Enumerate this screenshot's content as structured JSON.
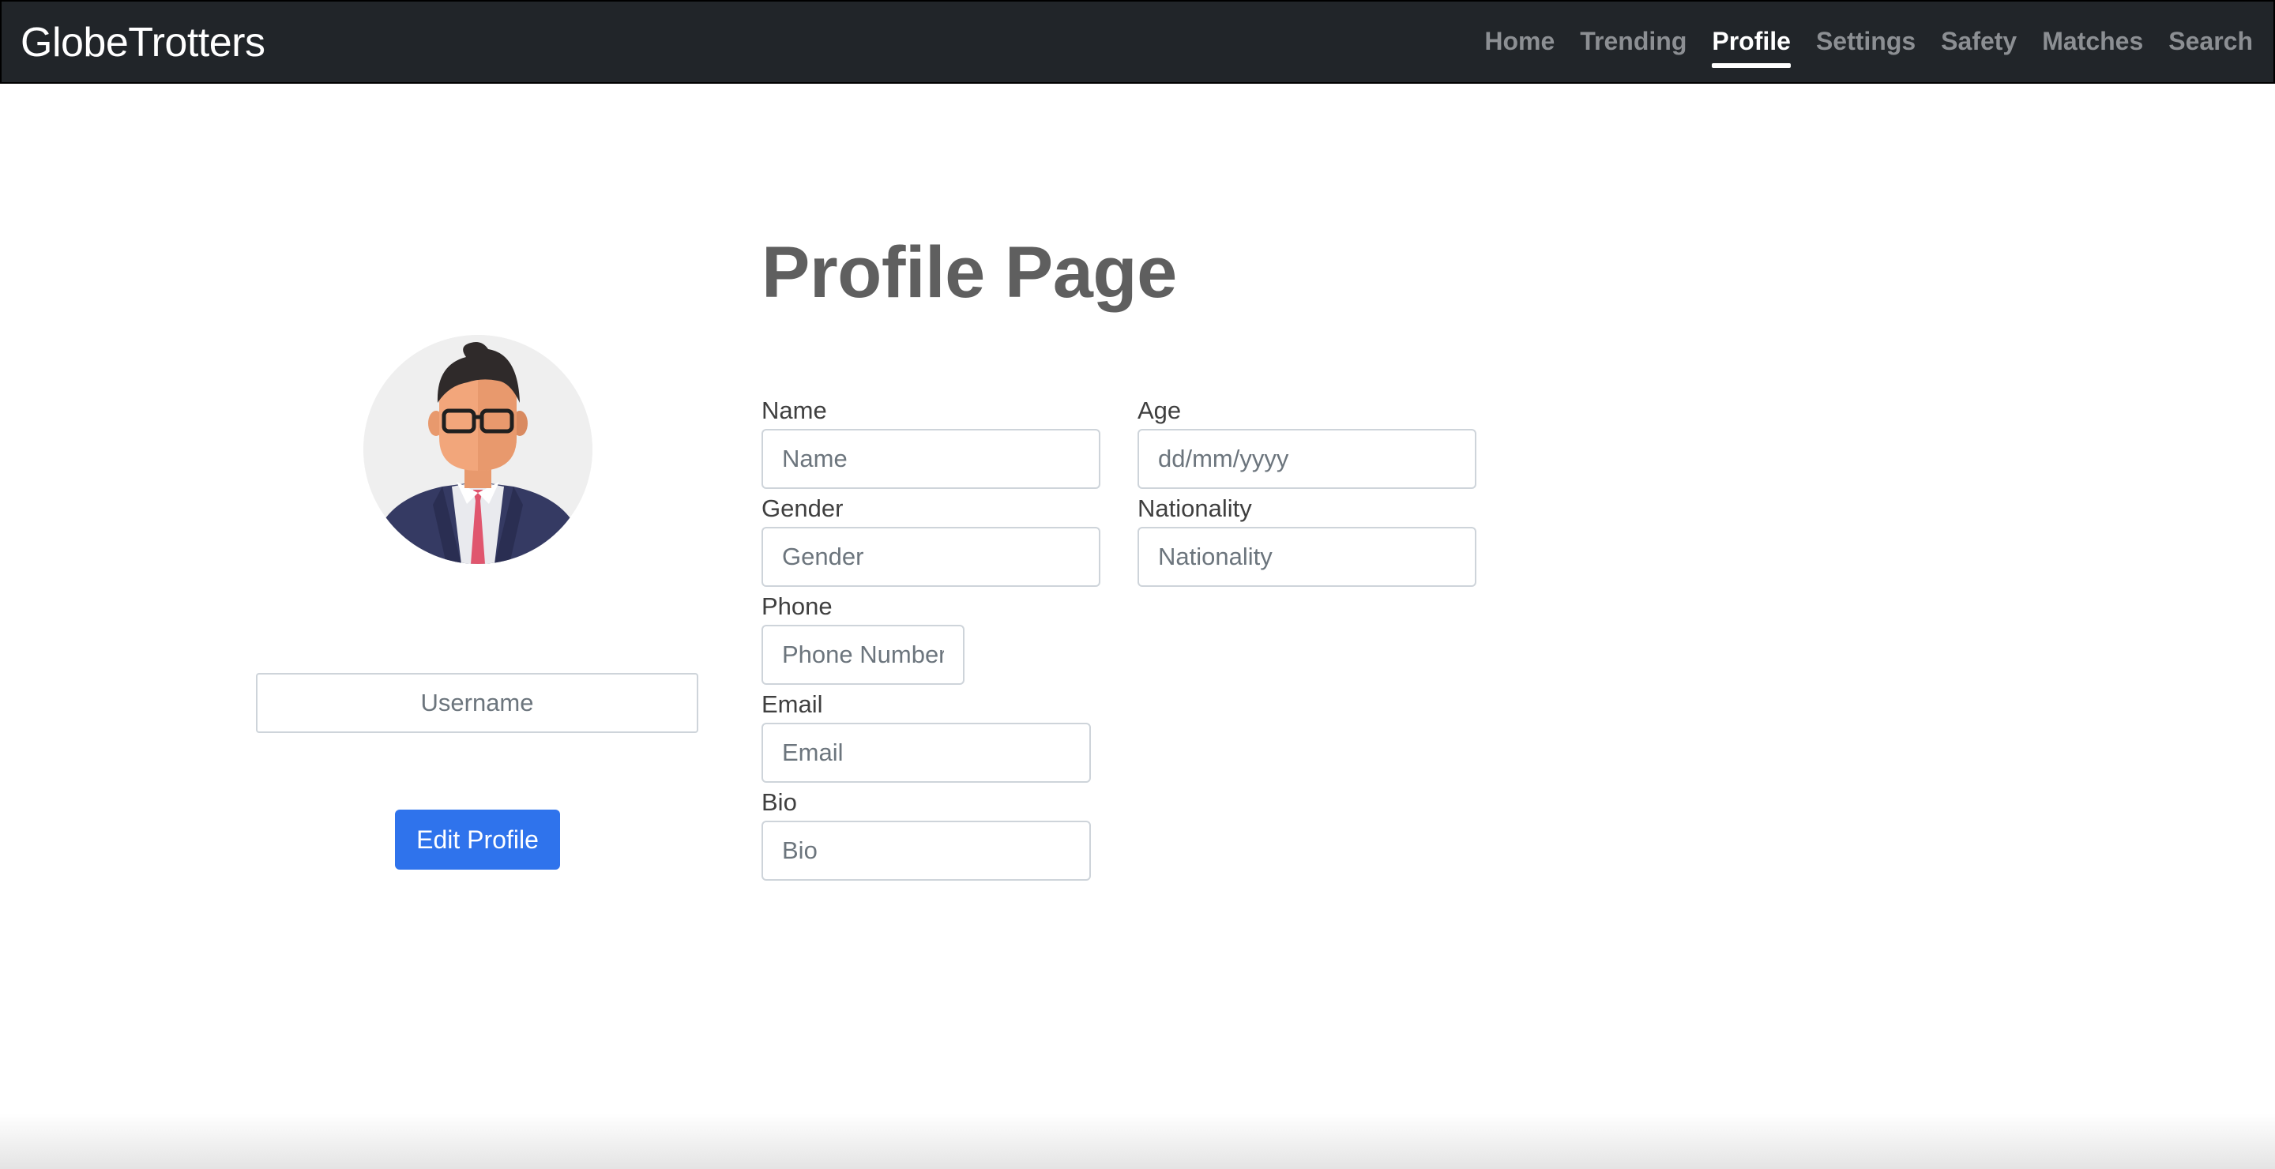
{
  "navbar": {
    "brand": "GlobeTrotters",
    "links": [
      {
        "label": "Home"
      },
      {
        "label": "Trending"
      },
      {
        "label": "Profile",
        "active": true
      },
      {
        "label": "Settings"
      },
      {
        "label": "Safety"
      },
      {
        "label": "Matches"
      },
      {
        "label": "Search"
      }
    ]
  },
  "sidebar": {
    "avatar_icon": "businessman-avatar-icon",
    "username_placeholder": "Username",
    "edit_button": "Edit Profile"
  },
  "main": {
    "title": "Profile Page",
    "fields": {
      "name": {
        "label": "Name",
        "placeholder": "Name"
      },
      "age": {
        "label": "Age",
        "placeholder": "dd/mm/yyyy"
      },
      "gender": {
        "label": "Gender",
        "placeholder": "Gender"
      },
      "nationality": {
        "label": "Nationality",
        "placeholder": "Nationality"
      },
      "phone": {
        "label": "Phone",
        "placeholder": "Phone Number"
      },
      "email": {
        "label": "Email",
        "placeholder": "Email"
      },
      "bio": {
        "label": "Bio",
        "placeholder": "Bio"
      }
    }
  },
  "colors": {
    "navbar_bg": "#212529",
    "primary_button": "#2f73ec",
    "title_text": "#5f5f5f"
  }
}
